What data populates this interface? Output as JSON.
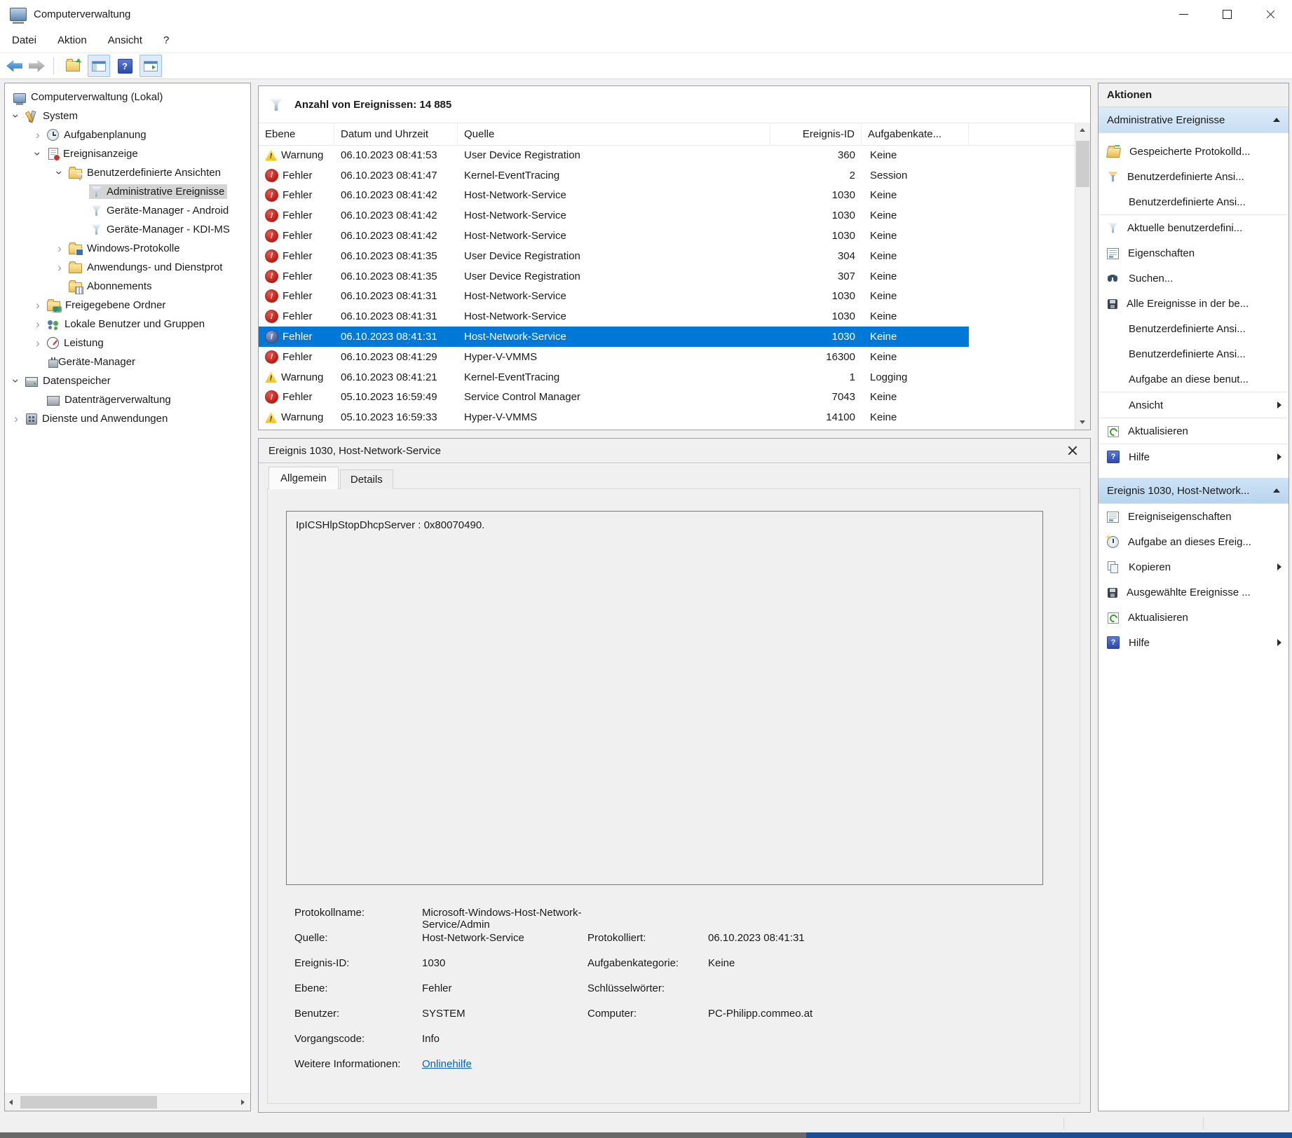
{
  "window": {
    "title": "Computerverwaltung"
  },
  "menu": {
    "items": [
      {
        "label": "Datei"
      },
      {
        "label": "Aktion"
      },
      {
        "label": "Ansicht"
      },
      {
        "label": "?"
      }
    ]
  },
  "toolbar": {
    "icons": [
      "back",
      "forward",
      "export-folder",
      "show-console-tree",
      "help",
      "show-action-pane"
    ]
  },
  "tree": {
    "items": [
      {
        "label": "Computerverwaltung (Lokal)",
        "level": 0,
        "expander": "",
        "icon": "computer-icon",
        "selected": false
      },
      {
        "label": "System",
        "level": 1,
        "expander": "expanded",
        "icon": "system-tools-icon",
        "selected": false
      },
      {
        "label": "Aufgabenplanung",
        "level": 2,
        "expander": "collapsed",
        "icon": "task-scheduler-icon",
        "selected": false
      },
      {
        "label": "Ereignisanzeige",
        "level": 2,
        "expander": "expanded",
        "icon": "event-viewer-icon",
        "selected": false
      },
      {
        "label": "Benutzerdefinierte Ansichten",
        "level": 3,
        "expander": "expanded",
        "icon": "folder-filter-icon",
        "selected": false
      },
      {
        "label": "Administrative Ereignisse",
        "level": 4,
        "expander": "",
        "icon": "filter-icon",
        "selected": true
      },
      {
        "label": "Geräte-Manager - Android",
        "level": 4,
        "expander": "",
        "icon": "filter-icon",
        "selected": false
      },
      {
        "label": "Geräte-Manager - KDI-MS",
        "level": 4,
        "expander": "",
        "icon": "filter-icon",
        "selected": false
      },
      {
        "label": "Windows-Protokolle",
        "level": 3,
        "expander": "collapsed",
        "icon": "folder-logs-icon",
        "selected": false
      },
      {
        "label": "Anwendungs- und Dienstprot",
        "level": 3,
        "expander": "collapsed",
        "icon": "folder-icon",
        "selected": false
      },
      {
        "label": "Abonnements",
        "level": 3,
        "expander": "",
        "icon": "folder-subscriptions-icon",
        "selected": false
      },
      {
        "label": "Freigegebene Ordner",
        "level": 2,
        "expander": "collapsed",
        "icon": "shared-folder-icon",
        "selected": false
      },
      {
        "label": "Lokale Benutzer und Gruppen",
        "level": 2,
        "expander": "collapsed",
        "icon": "users-icon",
        "selected": false
      },
      {
        "label": "Leistung",
        "level": 2,
        "expander": "collapsed",
        "icon": "performance-icon",
        "selected": false
      },
      {
        "label": "Geräte-Manager",
        "level": 2,
        "expander": "",
        "icon": "device-manager-icon",
        "selected": false
      },
      {
        "label": "Datenspeicher",
        "level": 1,
        "expander": "expanded",
        "icon": "storage-icon",
        "selected": false
      },
      {
        "label": "Datenträgerverwaltung",
        "level": 2,
        "expander": "",
        "icon": "disk-management-icon",
        "selected": false
      },
      {
        "label": "Dienste und Anwendungen",
        "level": 1,
        "expander": "collapsed",
        "icon": "services-icon",
        "selected": false
      }
    ]
  },
  "events": {
    "summary": "Anzahl von Ereignissen: 14 885",
    "columns": [
      {
        "label": "Ebene"
      },
      {
        "label": "Datum und Uhrzeit"
      },
      {
        "label": "Quelle"
      },
      {
        "label": "Ereignis-ID"
      },
      {
        "label": "Aufgabenkate..."
      }
    ],
    "rows": [
      {
        "level": "Warnung",
        "icon": "warning",
        "datetime": "06.10.2023 08:41:53",
        "source": "User Device Registration",
        "event_id": "360",
        "category": "Keine",
        "selected": false
      },
      {
        "level": "Fehler",
        "icon": "error",
        "datetime": "06.10.2023 08:41:47",
        "source": "Kernel-EventTracing",
        "event_id": "2",
        "category": "Session",
        "selected": false
      },
      {
        "level": "Fehler",
        "icon": "error",
        "datetime": "06.10.2023 08:41:42",
        "source": "Host-Network-Service",
        "event_id": "1030",
        "category": "Keine",
        "selected": false
      },
      {
        "level": "Fehler",
        "icon": "error",
        "datetime": "06.10.2023 08:41:42",
        "source": "Host-Network-Service",
        "event_id": "1030",
        "category": "Keine",
        "selected": false
      },
      {
        "level": "Fehler",
        "icon": "error",
        "datetime": "06.10.2023 08:41:42",
        "source": "Host-Network-Service",
        "event_id": "1030",
        "category": "Keine",
        "selected": false
      },
      {
        "level": "Fehler",
        "icon": "error",
        "datetime": "06.10.2023 08:41:35",
        "source": "User Device Registration",
        "event_id": "304",
        "category": "Keine",
        "selected": false
      },
      {
        "level": "Fehler",
        "icon": "error",
        "datetime": "06.10.2023 08:41:35",
        "source": "User Device Registration",
        "event_id": "307",
        "category": "Keine",
        "selected": false
      },
      {
        "level": "Fehler",
        "icon": "error",
        "datetime": "06.10.2023 08:41:31",
        "source": "Host-Network-Service",
        "event_id": "1030",
        "category": "Keine",
        "selected": false
      },
      {
        "level": "Fehler",
        "icon": "error",
        "datetime": "06.10.2023 08:41:31",
        "source": "Host-Network-Service",
        "event_id": "1030",
        "category": "Keine",
        "selected": false
      },
      {
        "level": "Fehler",
        "icon": "error",
        "datetime": "06.10.2023 08:41:31",
        "source": "Host-Network-Service",
        "event_id": "1030",
        "category": "Keine",
        "selected": true
      },
      {
        "level": "Fehler",
        "icon": "error",
        "datetime": "06.10.2023 08:41:29",
        "source": "Hyper-V-VMMS",
        "event_id": "16300",
        "category": "Keine",
        "selected": false
      },
      {
        "level": "Warnung",
        "icon": "warning",
        "datetime": "06.10.2023 08:41:21",
        "source": "Kernel-EventTracing",
        "event_id": "1",
        "category": "Logging",
        "selected": false
      },
      {
        "level": "Fehler",
        "icon": "error",
        "datetime": "05.10.2023 16:59:49",
        "source": "Service Control Manager",
        "event_id": "7043",
        "category": "Keine",
        "selected": false
      },
      {
        "level": "Warnung",
        "icon": "warning",
        "datetime": "05.10.2023 16:59:33",
        "source": "Hyper-V-VMMS",
        "event_id": "14100",
        "category": "Keine",
        "selected": false
      },
      {
        "level": "",
        "icon": "error",
        "datetime": "",
        "source": "",
        "event_id": "",
        "category": "",
        "selected": false
      }
    ]
  },
  "details": {
    "title": "Ereignis 1030, Host-Network-Service",
    "tabs": [
      {
        "label": "Allgemein",
        "active": true
      },
      {
        "label": "Details",
        "active": false
      }
    ],
    "message": "IpICSHlpStopDhcpServer : 0x80070490.",
    "field_rows": [
      {
        "label_left": "Protokollname:",
        "value_left": "Microsoft-Windows-Host-Network-Service/Admin",
        "label_right": "",
        "value_right": ""
      },
      {
        "label_left": "Quelle:",
        "value_left": "Host-Network-Service",
        "label_right": "Protokolliert:",
        "value_right": "06.10.2023 08:41:31"
      },
      {
        "label_left": "Ereignis-ID:",
        "value_left": "1030",
        "label_right": "Aufgabenkategorie:",
        "value_right": "Keine"
      },
      {
        "label_left": "Ebene:",
        "value_left": "Fehler",
        "label_right": "Schlüsselwörter:",
        "value_right": ""
      },
      {
        "label_left": "Benutzer:",
        "value_left": "SYSTEM",
        "label_right": "Computer:",
        "value_right": "PC-Philipp.commeo.at"
      },
      {
        "label_left": "Vorgangscode:",
        "value_left": "Info",
        "label_right": "",
        "value_right": ""
      },
      {
        "label_left": "Weitere Informationen:",
        "value_left": "Onlinehilfe",
        "label_right": "",
        "value_right": ""
      }
    ]
  },
  "actions": {
    "title": "Aktionen",
    "sections": [
      {
        "header": "Administrative Ereignisse",
        "items": [
          {
            "label": "Gespeicherte Protokolld...",
            "icon": "open-saved-log-icon"
          },
          {
            "label": "Benutzerdefinierte Ansi...",
            "icon": "create-filter-icon"
          },
          {
            "label": "Benutzerdefinierte Ansi...",
            "icon": ""
          },
          {
            "label": "Aktuelle benutzerdefini...",
            "icon": "filter-icon"
          },
          {
            "label": "Eigenschaften",
            "icon": "properties-icon"
          },
          {
            "label": "Suchen...",
            "icon": "find-icon"
          },
          {
            "label": "Alle Ereignisse in der be...",
            "icon": "save-icon"
          },
          {
            "label": "Benutzerdefinierte Ansi...",
            "icon": ""
          },
          {
            "label": "Benutzerdefinierte Ansi...",
            "icon": ""
          },
          {
            "label": "Aufgabe an diese benut...",
            "icon": ""
          },
          {
            "label": "Ansicht",
            "icon": "",
            "submenu": true
          },
          {
            "label": "Aktualisieren",
            "icon": "refresh-icon"
          },
          {
            "label": "Hilfe",
            "icon": "help-icon",
            "submenu": true
          }
        ]
      },
      {
        "header": "Ereignis 1030, Host-Network...",
        "items": [
          {
            "label": "Ereigniseigenschaften",
            "icon": "properties-icon"
          },
          {
            "label": "Aufgabe an dieses Ereig...",
            "icon": "attach-task-icon"
          },
          {
            "label": "Kopieren",
            "icon": "copy-icon",
            "submenu": true
          },
          {
            "label": "Ausgewählte Ereignisse ...",
            "icon": "save-icon"
          },
          {
            "label": "Aktualisieren",
            "icon": "refresh-icon"
          },
          {
            "label": "Hilfe",
            "icon": "help-icon",
            "submenu": true
          }
        ]
      }
    ]
  },
  "colors": {
    "selection": "#0078d7",
    "error": "#c42b1c",
    "warning": "#f5c511",
    "link": "#0563c1",
    "section_header": "#c9def2"
  }
}
